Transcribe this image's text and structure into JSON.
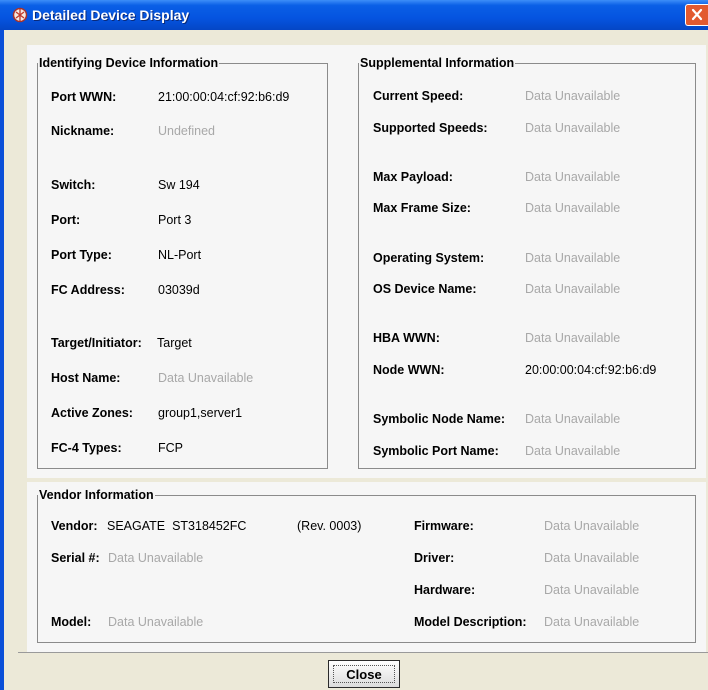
{
  "window": {
    "title": "Detailed Device Display"
  },
  "identifying": {
    "legend": "Identifying Device Information",
    "rows": [
      {
        "label": "Port WWN:",
        "value": "21:00:00:04:cf:92:b6:d9",
        "na": false
      },
      {
        "label": "Nickname:",
        "value": "Undefined",
        "na": true
      },
      {
        "label": "Switch:",
        "value": "Sw 194",
        "na": false
      },
      {
        "label": "Port:",
        "value": "Port 3",
        "na": false
      },
      {
        "label": "Port Type:",
        "value": "NL-Port",
        "na": false
      },
      {
        "label": "FC Address:",
        "value": "03039d",
        "na": false
      },
      {
        "label": "Target/Initiator:",
        "value": "Target",
        "na": false
      },
      {
        "label": "Host Name:",
        "value": "Data Unavailable",
        "na": true
      },
      {
        "label": "Active Zones:",
        "value": "group1,server1",
        "na": false
      },
      {
        "label": "FC-4 Types:",
        "value": "FCP",
        "na": false
      }
    ]
  },
  "supplemental": {
    "legend": "Supplemental Information",
    "rows": [
      {
        "label": "Current Speed:",
        "value": "Data Unavailable",
        "na": true
      },
      {
        "label": "Supported Speeds:",
        "value": "Data Unavailable",
        "na": true
      },
      {
        "label": "Max Payload:",
        "value": "Data Unavailable",
        "na": true
      },
      {
        "label": "Max Frame Size:",
        "value": "Data Unavailable",
        "na": true
      },
      {
        "label": "Operating System:",
        "value": "Data Unavailable",
        "na": true
      },
      {
        "label": "OS Device Name:",
        "value": "Data Unavailable",
        "na": true
      },
      {
        "label": "HBA WWN:",
        "value": "Data Unavailable",
        "na": true
      },
      {
        "label": "Node WWN:",
        "value": "20:00:00:04:cf:92:b6:d9",
        "na": false
      },
      {
        "label": "Symbolic Node Name:",
        "value": "Data Unavailable",
        "na": true
      },
      {
        "label": "Symbolic Port Name:",
        "value": "Data Unavailable",
        "na": true
      }
    ]
  },
  "vendor": {
    "legend": "Vendor Information",
    "vendor_label": "Vendor:",
    "vendor_value": "SEAGATE  ST318452FC",
    "revision": "(Rev. 0003)",
    "serial_label": "Serial #:",
    "serial_value": "Data Unavailable",
    "model_label": "Model:",
    "model_value": "Data Unavailable",
    "right": [
      {
        "label": "Firmware:",
        "value": "Data Unavailable",
        "na": true
      },
      {
        "label": "Driver:",
        "value": "Data Unavailable",
        "na": true
      },
      {
        "label": "Hardware:",
        "value": "Data Unavailable",
        "na": true
      },
      {
        "label": "Model Description:",
        "value": "Data Unavailable",
        "na": true
      }
    ]
  },
  "buttons": {
    "close_label": "Close"
  },
  "colors": {
    "titlebar": "#0554e0",
    "close_x": "#e25a30",
    "unavailable_text": "#a8a8a8"
  }
}
